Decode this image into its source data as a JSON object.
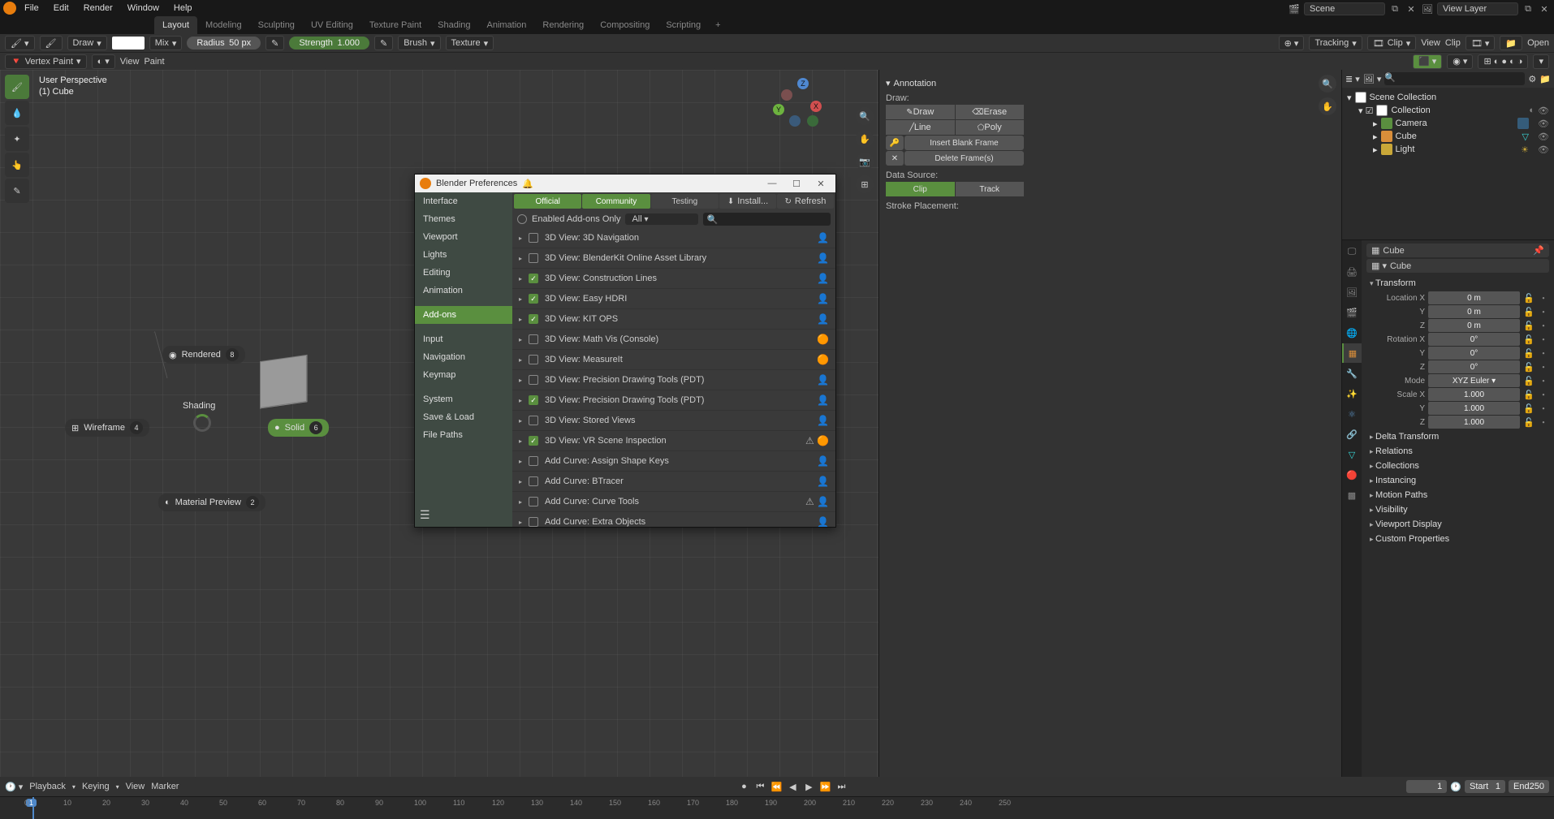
{
  "top_menu": [
    "File",
    "Edit",
    "Render",
    "Window",
    "Help"
  ],
  "workspace_tabs": [
    "Layout",
    "Modeling",
    "Sculpting",
    "UV Editing",
    "Texture Paint",
    "Shading",
    "Animation",
    "Rendering",
    "Compositing",
    "Scripting"
  ],
  "active_workspace": "Layout",
  "scene_name": "Scene",
  "view_layer": "View Layer",
  "header": {
    "mode_brush": "Draw",
    "blend": "Mix",
    "radius_label": "Radius",
    "radius_value": "50 px",
    "strength_label": "Strength",
    "strength_value": "1.000",
    "brush_menu": "Brush",
    "texture_menu": "Texture"
  },
  "header2": {
    "mode": "Vertex Paint",
    "view": "View",
    "paint": "Paint"
  },
  "clip_header": {
    "tracking": "Tracking",
    "clip": "Clip",
    "view": "View",
    "clip2": "Clip",
    "open": "Open"
  },
  "vp_info": {
    "line1": "User Perspective",
    "line2": "(1) Cube"
  },
  "pie": {
    "rendered": "Rendered",
    "rendered_n": "8",
    "wireframe": "Wireframe",
    "wireframe_n": "4",
    "solid": "Solid",
    "solid_n": "6",
    "matprev": "Material Preview",
    "matprev_n": "2",
    "shading": "Shading"
  },
  "npanel": {
    "title": "Annotation",
    "draw_label": "Draw:",
    "draw": "Draw",
    "line": "Line",
    "erase": "Erase",
    "poly": "Poly",
    "insert": "Insert Blank Frame",
    "delete": "Delete Frame(s)",
    "data_source_label": "Data Source:",
    "clip": "Clip",
    "track": "Track",
    "stroke_placement": "Stroke Placement:"
  },
  "outliner": {
    "collection_root": "Scene Collection",
    "collection": "Collection",
    "items": [
      "Camera",
      "Cube",
      "Light"
    ]
  },
  "props": {
    "obj": "Cube",
    "mesh": "Cube",
    "transform": "Transform",
    "location": "Location",
    "rotation": "Rotation",
    "scale": "Scale",
    "mode_label": "Mode",
    "mode_value": "XYZ Euler",
    "loc": [
      "0 m",
      "0 m",
      "0 m"
    ],
    "rot": [
      "0°",
      "0°",
      "0°"
    ],
    "scl": [
      "1.000",
      "1.000",
      "1.000"
    ],
    "axes": [
      "X",
      "Y",
      "Z"
    ],
    "sections": [
      "Delta Transform",
      "Relations",
      "Collections",
      "Instancing",
      "Motion Paths",
      "Visibility",
      "Viewport Display",
      "Custom Properties"
    ]
  },
  "timeline": {
    "playback": "Playback",
    "keying": "Keying",
    "view": "View",
    "marker": "Marker",
    "current": "1",
    "start_label": "Start",
    "start": "1",
    "end_label": "End",
    "end": "250",
    "ticks": [
      0,
      10,
      20,
      30,
      40,
      50,
      60,
      70,
      80,
      90,
      100,
      110,
      120,
      130,
      140,
      150,
      160,
      170,
      180,
      190,
      200,
      210,
      220,
      230,
      240,
      250
    ]
  },
  "prefs": {
    "title": "Blender Preferences",
    "categories": [
      "Interface",
      "Themes",
      "Viewport",
      "Lights",
      "Editing",
      "Animation",
      "",
      "Add-ons",
      "",
      "Input",
      "Navigation",
      "Keymap",
      "",
      "System",
      "Save & Load",
      "File Paths"
    ],
    "active_category": "Add-ons",
    "support": [
      "Official",
      "Community",
      "Testing"
    ],
    "install": "Install...",
    "refresh": "Refresh",
    "enabled_only": "Enabled Add-ons Only",
    "filter": "All",
    "addons": [
      {
        "on": false,
        "name": "3D View: 3D Navigation",
        "icon": "user"
      },
      {
        "on": false,
        "name": "3D View: BlenderKit Online Asset Library",
        "icon": "user"
      },
      {
        "on": true,
        "name": "3D View: Construction Lines",
        "icon": "user"
      },
      {
        "on": true,
        "name": "3D View: Easy HDRI",
        "icon": "user"
      },
      {
        "on": true,
        "name": "3D View: KIT OPS",
        "icon": "user"
      },
      {
        "on": false,
        "name": "3D View: Math Vis (Console)",
        "icon": "blender"
      },
      {
        "on": false,
        "name": "3D View: MeasureIt",
        "icon": "blender"
      },
      {
        "on": false,
        "name": "3D View: Precision Drawing Tools (PDT)",
        "icon": "user"
      },
      {
        "on": true,
        "name": "3D View: Precision Drawing Tools (PDT)",
        "icon": "user"
      },
      {
        "on": false,
        "name": "3D View: Stored Views",
        "icon": "user"
      },
      {
        "on": true,
        "name": "3D View: VR Scene Inspection",
        "icon": "warn-blender"
      },
      {
        "on": false,
        "name": "Add Curve: Assign Shape Keys",
        "icon": "user"
      },
      {
        "on": false,
        "name": "Add Curve: BTracer",
        "icon": "user"
      },
      {
        "on": false,
        "name": "Add Curve: Curve Tools",
        "icon": "warn-user"
      },
      {
        "on": false,
        "name": "Add Curve: Extra Objects",
        "icon": "user"
      }
    ]
  }
}
